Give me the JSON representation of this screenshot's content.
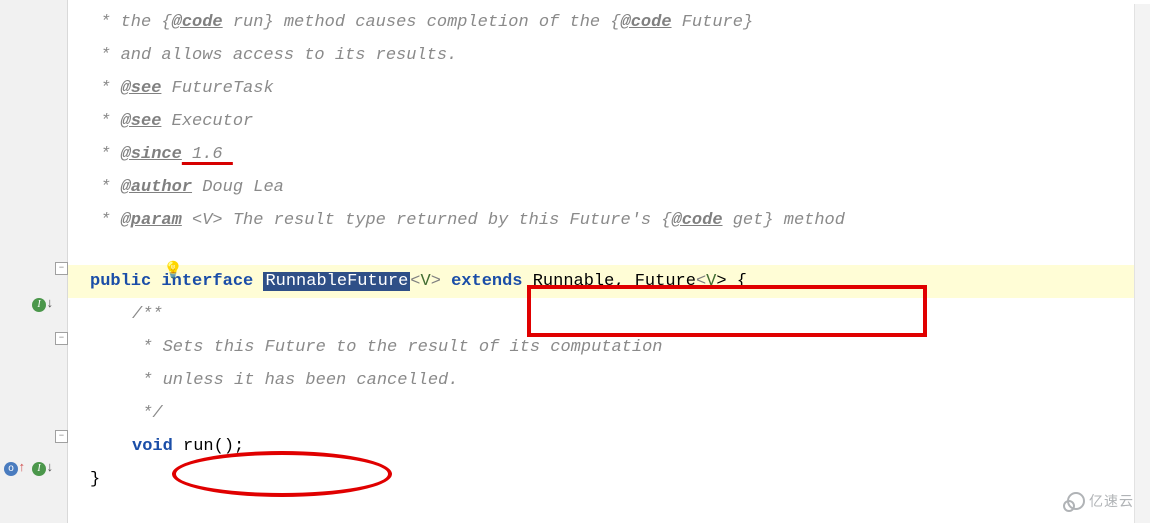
{
  "javadoc": {
    "line1_a": " * the {",
    "line1_code": "@code",
    "line1_b": " run} method causes completion of the {",
    "line1_c": " Future}",
    "line2": " * and allows access to its results.",
    "see1_tag": "@see",
    "see1_val": " FutureTask",
    "see2_tag": "@see",
    "see2_val": " Executor",
    "since_tag": "@since",
    "since_val": " 1.6 ",
    "author_tag": "@author",
    "author_val": " Doug Lea",
    "param_tag": "@param",
    "param_a": " <V> The result type returned by this Future's {",
    "param_b": " get} method",
    "comment_open": "/**",
    "comment_mid1": " * Sets this Future to the result of its computation",
    "comment_mid2": " * unless it has been cancelled.",
    "comment_close": " */"
  },
  "decl": {
    "public": "public",
    "interface": "interface",
    "name": "RunnableFuture",
    "lt": "<",
    "v": "V",
    "gt": ">",
    "extends": "extends",
    "impl": " Runnable, Future",
    "lt2": "<",
    "v2": "V",
    "gt2": "> {"
  },
  "method": {
    "void": "void",
    "sig": " run();"
  },
  "close_brace": "}",
  "icons": {
    "bulb": "💡",
    "fold_minus": "−"
  },
  "watermark": "亿速云"
}
